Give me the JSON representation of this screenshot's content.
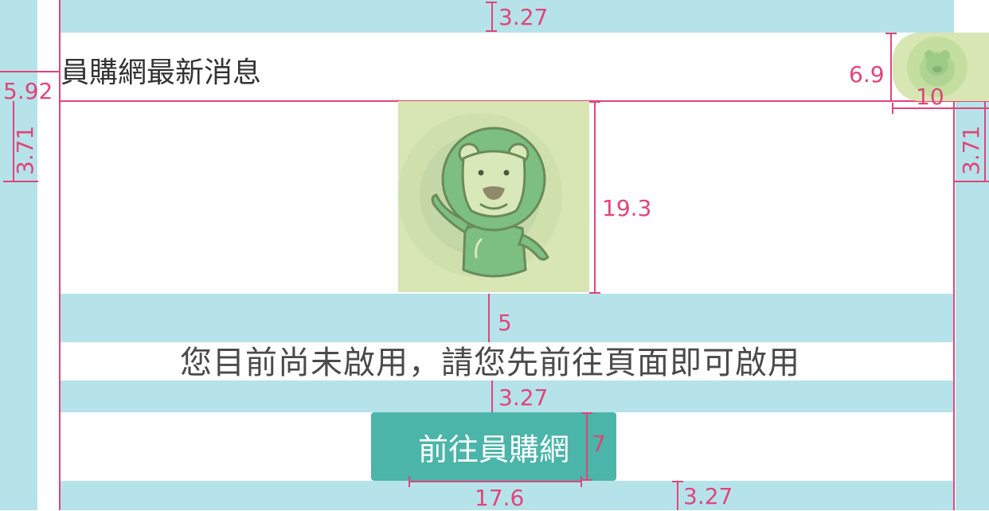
{
  "title": "員購網最新消息",
  "message": "您目前尚未啟用，請您先前往頁面即可啟用",
  "button_label": "前往員購網",
  "dimensions": {
    "top_gap": "3.27",
    "corner_height": "6.9",
    "corner_width": "10",
    "title_height": "5.92",
    "side_left": "3.71",
    "side_right": "3.71",
    "hero_height": "19.3",
    "hero_gap": "5",
    "message_gap": "3.27",
    "button_height": "7",
    "button_width": "17.6",
    "bottom_gap": "3.27"
  },
  "icons": {
    "hero": "bear-mascot-icon",
    "corner": "bear-badge-icon"
  },
  "colors": {
    "accent": "#4bb5a9",
    "spacer": "#b6e3ea",
    "guide": "#e0457b",
    "dimension_text": "#e0457b",
    "hero_background": "#d7e6b3",
    "bear_green": "#7cbf80"
  }
}
